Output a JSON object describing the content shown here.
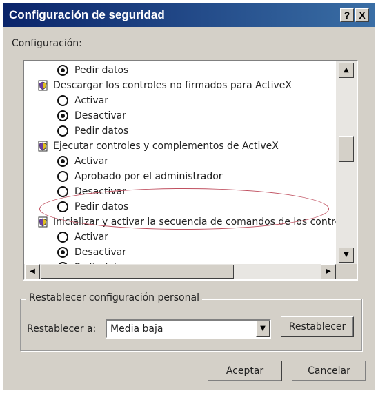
{
  "window": {
    "title": "Configuración de seguridad",
    "help_glyph": "?",
    "close_glyph": "X"
  },
  "config_label": "Configuración:",
  "settings": [
    {
      "kind": "option",
      "label": "Pedir datos",
      "selected": true
    },
    {
      "kind": "header",
      "label": "Descargar los controles no firmados para ActiveX"
    },
    {
      "kind": "option",
      "label": "Activar",
      "selected": false
    },
    {
      "kind": "option",
      "label": "Desactivar",
      "selected": true
    },
    {
      "kind": "option",
      "label": "Pedir datos",
      "selected": false
    },
    {
      "kind": "header",
      "label": "Ejecutar controles y complementos de ActiveX"
    },
    {
      "kind": "option",
      "label": "Activar",
      "selected": true
    },
    {
      "kind": "option",
      "label": "Aprobado por el administrador",
      "selected": false
    },
    {
      "kind": "option",
      "label": "Desactivar",
      "selected": false
    },
    {
      "kind": "option",
      "label": "Pedir datos",
      "selected": false
    },
    {
      "kind": "header",
      "label": "Inicializar y activar la secuencia de comandos de los controles d"
    },
    {
      "kind": "option",
      "label": "Activar",
      "selected": false
    },
    {
      "kind": "option",
      "label": "Desactivar",
      "selected": true
    },
    {
      "kind": "option",
      "label": "Pedir datos",
      "selected": false
    }
  ],
  "reset_group": {
    "title": "Restablecer configuración personal",
    "label": "Restablecer a:",
    "selected_level": "Media baja",
    "reset_button": "Restablecer"
  },
  "buttons": {
    "ok": "Aceptar",
    "cancel": "Cancelar"
  },
  "colors": {
    "title_start": "#0a246a",
    "title_end": "#3a6ea5",
    "dialog_bg": "#d4d0c8",
    "highlight_ellipse": "#c05060"
  }
}
